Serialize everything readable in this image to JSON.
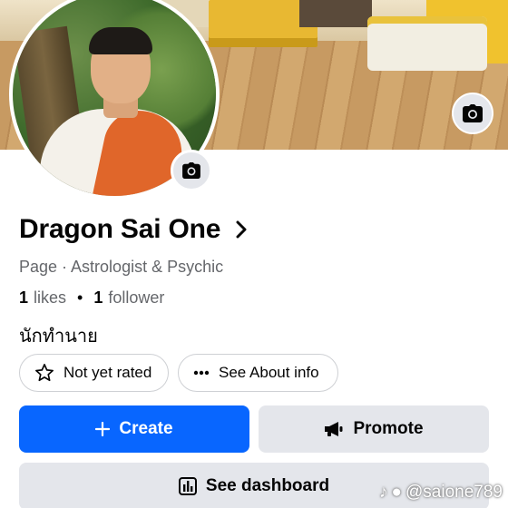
{
  "profile": {
    "name": "Dragon Sai One",
    "category": "Page · Astrologist & Psychic",
    "likes_count": "1",
    "likes_label": "likes",
    "followers_count": "1",
    "followers_label": "follower",
    "bio": "นักทำนาย"
  },
  "chips": {
    "rating": "Not yet rated",
    "about": "See About info"
  },
  "actions": {
    "create": "Create",
    "promote": "Promote",
    "dashboard": "See dashboard"
  },
  "watermark": {
    "handle": "@saione789"
  },
  "colors": {
    "primary": "#0866ff",
    "secondary_button": "#e4e6eb",
    "muted_text": "#65676b",
    "sash": "#e0662a"
  },
  "icons": [
    "camera-icon",
    "chevron-right-icon",
    "star-outline-icon",
    "more-dots-icon",
    "plus-icon",
    "megaphone-icon",
    "dashboard-icon",
    "tiktok-icon",
    "person-icon"
  ]
}
